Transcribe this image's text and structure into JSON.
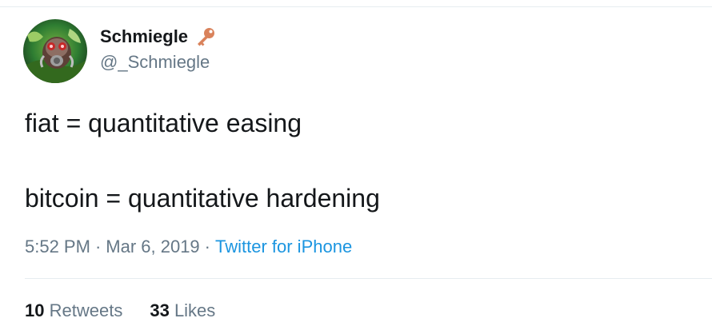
{
  "user": {
    "display_name": "Schmiegle",
    "handle": "@_Schmiegle",
    "badge_icon": "key-icon",
    "badge_color": "#d9825b"
  },
  "tweet": {
    "line_1": "fiat = quantitative easing",
    "line_2": "bitcoin = quantitative hardening"
  },
  "meta": {
    "time": "5:52 PM",
    "separator": "·",
    "date": "Mar 6, 2019",
    "source": "Twitter for iPhone",
    "link_color": "#1b95e0"
  },
  "stats": {
    "retweets_count": "10",
    "retweets_label": "Retweets",
    "likes_count": "33",
    "likes_label": "Likes"
  }
}
